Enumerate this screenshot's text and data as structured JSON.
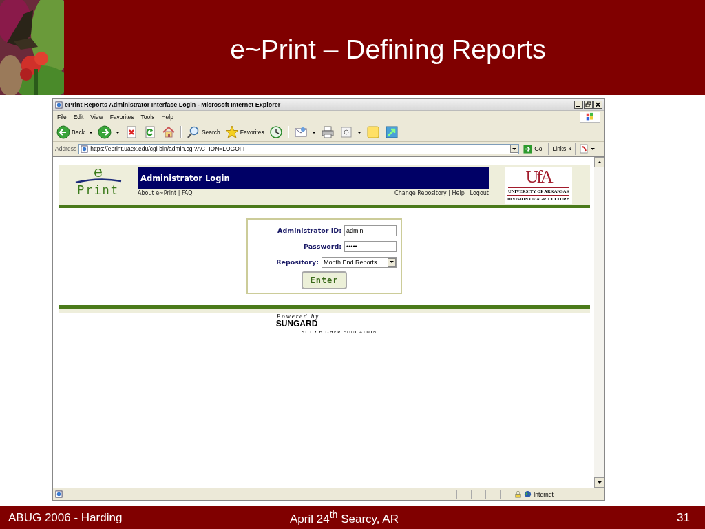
{
  "slide": {
    "title": "e~Print – Defining Reports",
    "footer_left": "ABUG 2006 - Harding",
    "footer_center": "April 24$^{th}$ Searcy, AR",
    "page_number": "31"
  },
  "browser": {
    "title": "ePrint Reports Administrator Interface Login - Microsoft Internet Explorer",
    "menu": [
      "File",
      "Edit",
      "View",
      "Favorites",
      "Tools",
      "Help"
    ],
    "toolbar_groups": [
      [
        {
          "kind": "back",
          "label": "Back",
          "dropdown": true
        },
        {
          "kind": "forward",
          "dropdown": true
        },
        {
          "kind": "stop",
          "dropdown": false
        },
        {
          "kind": "refresh",
          "dropdown": false
        },
        {
          "kind": "home",
          "dropdown": false
        }
      ],
      [
        {
          "kind": "search",
          "label": "Search",
          "dropdown": false
        },
        {
          "kind": "favorites",
          "label": "Favorites",
          "dropdown": false
        },
        {
          "kind": "history",
          "dropdown": false
        }
      ],
      [
        {
          "kind": "mail",
          "dropdown": true
        },
        {
          "kind": "print",
          "dropdown": false
        },
        {
          "kind": "edit",
          "dropdown": true
        },
        {
          "kind": "note",
          "dropdown": false
        },
        {
          "kind": "messenger",
          "dropdown": false
        }
      ]
    ],
    "address_label": "Address",
    "url": "https://eprint.uaex.edu/cgi-bin/admin.cgi?ACTION=LOGOFF",
    "go": "Go",
    "links": "Links",
    "links_more": "»",
    "status_zone": "Internet"
  },
  "page": {
    "logo_top": "e",
    "logo_bottom": "Print",
    "heading": "Administrator Login",
    "nav_left": "About e~Print | FAQ",
    "nav_right": "Change Repository | Help | Logout",
    "university_mark": "UfA",
    "university_lines": [
      "UNIVERSITY OF ARKANSAS",
      "DIVISION OF AGRICULTURE"
    ],
    "form": {
      "fields": [
        {
          "kind": "text",
          "label": "Administrator ID:",
          "value": "admin"
        },
        {
          "kind": "password",
          "label": "Password:",
          "value": "•••••"
        },
        {
          "kind": "select",
          "label": "Repository:",
          "value": "Month End Reports"
        }
      ],
      "submit": "Enter"
    },
    "powered": {
      "caption": "Powered by",
      "brand": "SUNGARD",
      "tagline": "SCT • HIGHER EDUCATION"
    }
  }
}
